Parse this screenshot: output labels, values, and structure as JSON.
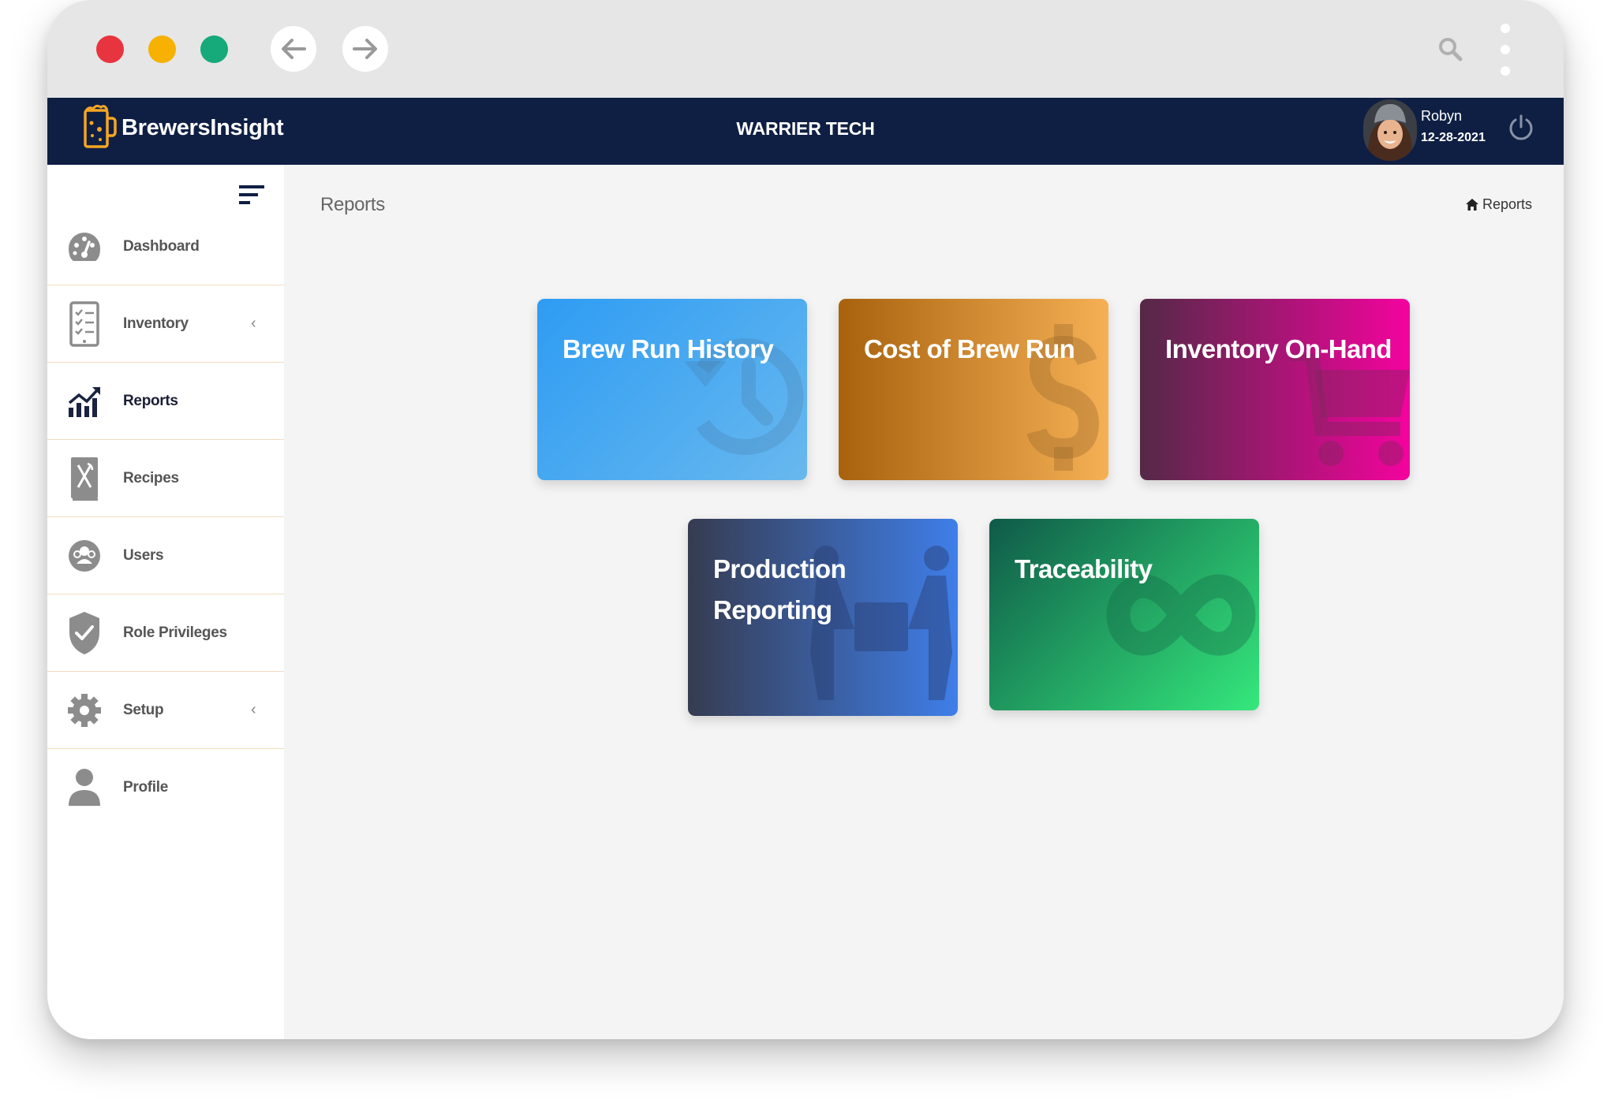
{
  "browser": {
    "back_icon": "arrow-left-icon",
    "forward_icon": "arrow-right-icon",
    "search_icon": "search-icon",
    "menu_icon": "kebab-menu-icon"
  },
  "header": {
    "brand": "BrewersInsight",
    "company": "WARRIER TECH",
    "user_name": "Robyn",
    "date": "12-28-2021",
    "power_icon": "power-icon"
  },
  "sidebar": {
    "items": [
      {
        "label": "Dashboard",
        "icon": "dashboard-gauge-icon"
      },
      {
        "label": "Inventory",
        "icon": "clipboard-list-icon",
        "chevron": "‹"
      },
      {
        "label": "Reports",
        "icon": "chart-trending-icon",
        "active": true
      },
      {
        "label": "Recipes",
        "icon": "recipe-book-icon"
      },
      {
        "label": "Users",
        "icon": "users-icon"
      },
      {
        "label": "Role Privileges",
        "icon": "shield-check-icon"
      },
      {
        "label": "Setup",
        "icon": "gear-icon",
        "chevron": "‹"
      },
      {
        "label": "Profile",
        "icon": "user-icon"
      }
    ]
  },
  "main": {
    "title": "Reports",
    "breadcrumb": "Reports",
    "cards": [
      {
        "title": "Brew Run History",
        "icon": "history-icon"
      },
      {
        "title": "Cost of Brew Run",
        "icon": "dollar-icon"
      },
      {
        "title": "Inventory On-Hand",
        "icon": "shopping-cart-icon"
      },
      {
        "title": "Production Reporting",
        "icon": "people-carry-box-icon"
      },
      {
        "title": "Traceability",
        "icon": "infinity-icon"
      }
    ]
  },
  "colors": {
    "topbar": "#0f1f44",
    "brand_accent": "#f5a623",
    "card_blue": "#2e9cf3",
    "card_orange": "#f5b055",
    "card_magenta": "#f4039e",
    "card_navy": "#3f7ee9",
    "card_green": "#35e87c"
  }
}
